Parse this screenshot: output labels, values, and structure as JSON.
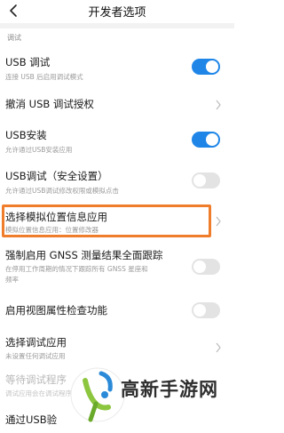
{
  "header": {
    "title": "开发者选项"
  },
  "section": {
    "label": "调试"
  },
  "rows": {
    "usb_debug": {
      "title": "USB 调试",
      "subtitle": "连接 USB 后启用调试模式",
      "state": "on"
    },
    "revoke": {
      "title": "撤消 USB 调试授权"
    },
    "usb_install": {
      "title": "USB安装",
      "subtitle": "允许通过USB安装应用",
      "state": "on"
    },
    "usb_secure": {
      "title": "USB调试（安全设置）",
      "subtitle": "允许通过USB调试修改权限或模拟点击",
      "state": "off"
    },
    "mock_location": {
      "title": "选择模拟位置信息应用",
      "subtitle": "模拟位置信息应用：位置修改器"
    },
    "gnss": {
      "title": "强制启用 GNSS 测量结果全面跟踪",
      "subtitle_line1": "在停用工作周期的情况下跟踪所有 GNSS 星座和",
      "subtitle_line2": "频率",
      "state": "off"
    },
    "view_attr": {
      "title": "启用视图属性检查功能",
      "state": "off"
    },
    "debug_app": {
      "title": "选择调试应用",
      "subtitle": "未设置任何调试应用"
    },
    "wait_debugger": {
      "title": "等待调试程序",
      "subtitle": "调试应用会在调试程序附加后运行"
    },
    "verify_usb": {
      "title": "通过USB验"
    }
  },
  "watermark": {
    "text": "高新手游网"
  },
  "colors": {
    "accent": "#1f86e8",
    "highlight": "#f07d2b"
  }
}
